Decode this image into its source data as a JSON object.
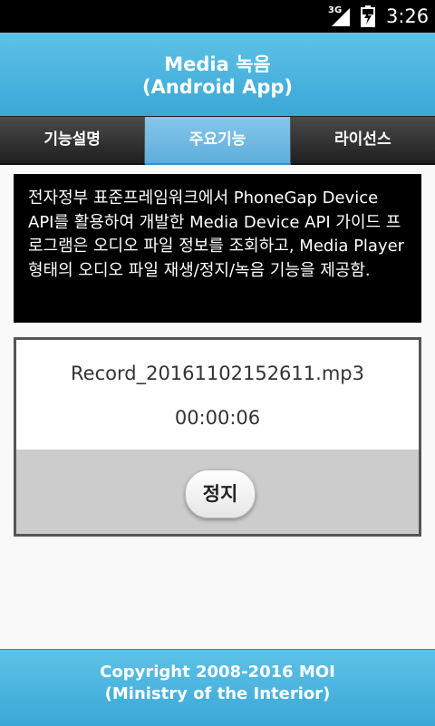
{
  "status_bar": {
    "network": "3G",
    "time": "3:26",
    "icons": [
      "signal-icon",
      "battery-icon"
    ]
  },
  "header": {
    "title_line1": "Media 녹음",
    "title_line2": "(Android App)"
  },
  "tabs": [
    {
      "label": "기능설명",
      "active": false
    },
    {
      "label": "주요기능",
      "active": true
    },
    {
      "label": "라이선스",
      "active": false
    }
  ],
  "description": "전자정부 표준프레임워크에서 PhoneGap Device API를 활용하여 개발한 Media Device API 가이드 프로그램은 오디오 파일 정보를 조회하고, Media Player 형태의 오디오 파일 재생/정지/녹음 기능을 제공함.",
  "player": {
    "file_name": "Record_20161102152611.mp3",
    "duration": "00:00:06",
    "stop_label": "정지"
  },
  "footer": {
    "line1": "Copyright 2008-2016 MOI",
    "line2": "(Ministry of the Interior)"
  },
  "colors": {
    "header_bg": "#3aa7d6",
    "tab_active": "#6bb6e0",
    "tab_inactive": "#2e2e2e"
  }
}
